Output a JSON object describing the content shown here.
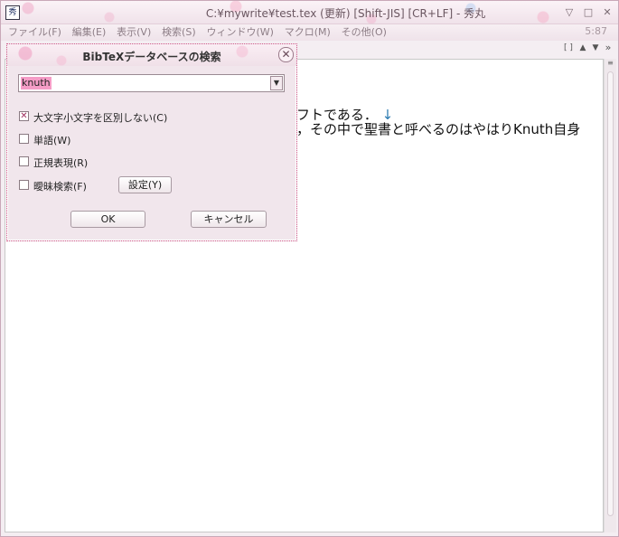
{
  "window": {
    "icon_text": "秀",
    "title": "C:¥mywrite¥test.tex (更新) [Shift-JIS] [CR+LF] - 秀丸",
    "minimize_glyph": "▽",
    "maximize_glyph": "□",
    "close_glyph": "✕"
  },
  "menubar": {
    "items": [
      "ファイル(F)",
      "編集(E)",
      "表示(V)",
      "検索(S)",
      "ウィンドウ(W)",
      "マクロ(M)",
      "その他(O)"
    ],
    "cursor_position": "5:87"
  },
  "tabrow": {
    "controls": [
      "[ ]",
      "▲",
      "▼",
      "»"
    ]
  },
  "editor": {
    "line1": "フトである．",
    "line1_newline": "↓",
    "line2": "，その中で聖書と呼べるのはやはりKnuth自身"
  },
  "dialog": {
    "title": "BibTeXデータベースの検索",
    "close_glyph": "✕",
    "search_value": "knuth",
    "combo_arrow": "▼",
    "options": {
      "case_insensitive": {
        "label": "大文字小文字を区別しない(C)",
        "checked": true,
        "mark": "✕"
      },
      "word": {
        "label": "単語(W)",
        "checked": false,
        "mark": ""
      },
      "regex": {
        "label": "正規表現(R)",
        "checked": false,
        "mark": ""
      },
      "fuzzy": {
        "label": "曖昧検索(F)",
        "checked": false,
        "mark": ""
      }
    },
    "settings_button": "設定(Y)",
    "ok_button": "OK",
    "cancel_button": "キャンセル"
  }
}
